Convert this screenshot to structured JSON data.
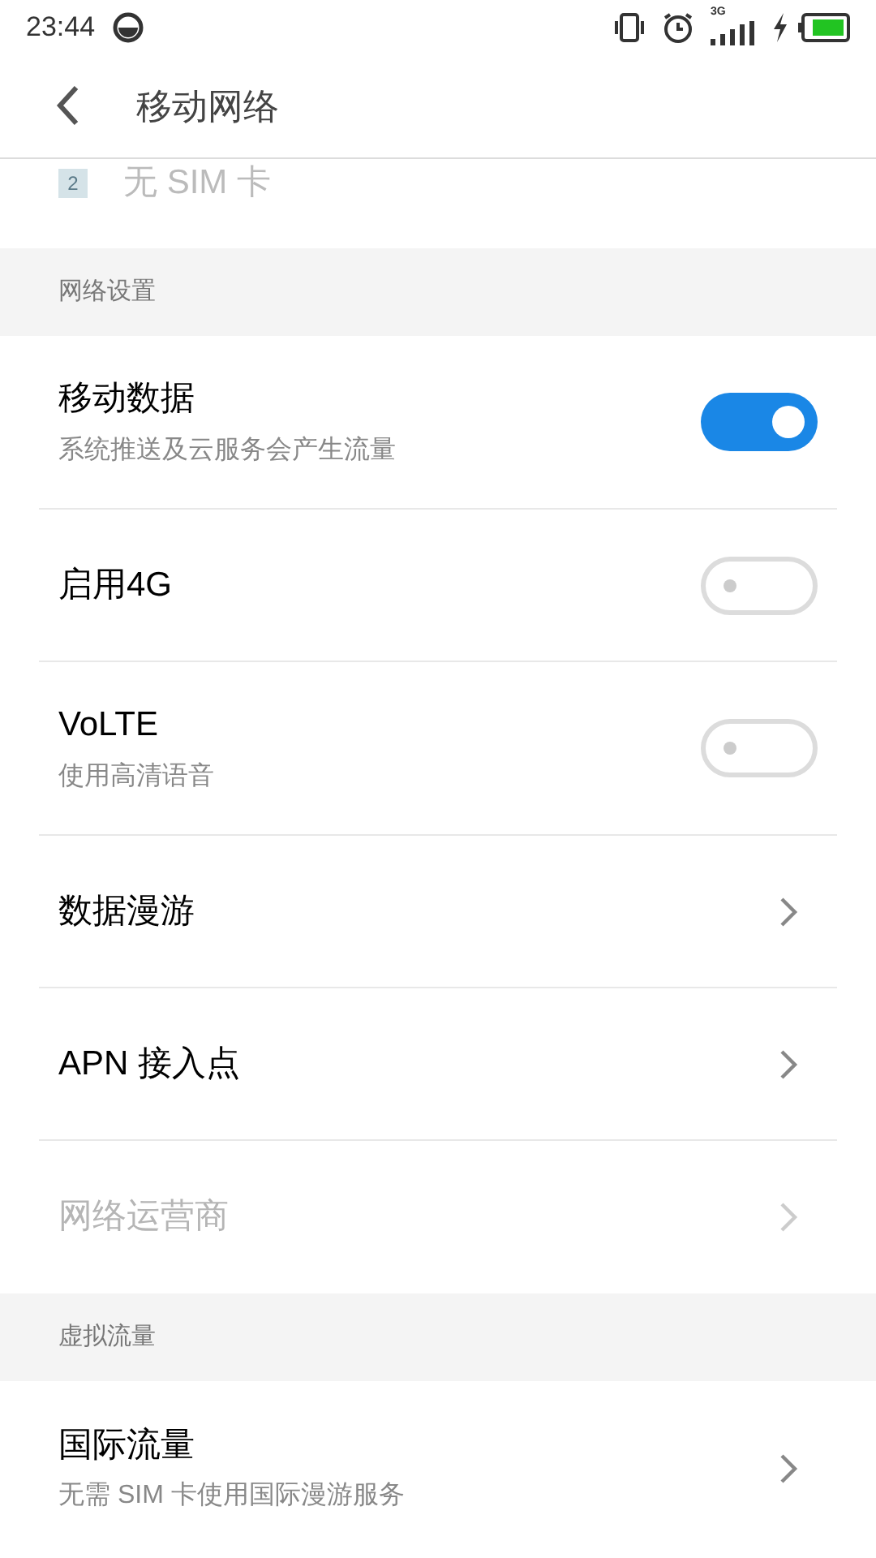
{
  "status_bar": {
    "time": "23:44",
    "network": "3G"
  },
  "header": {
    "title": "移动网络"
  },
  "sim_row": {
    "slot": "2",
    "label": "无 SIM 卡"
  },
  "sections": [
    {
      "title": "网络设置",
      "items": [
        {
          "kind": "toggle",
          "label": "移动数据",
          "subtitle": "系统推送及云服务会产生流量",
          "on": true,
          "disabled": false
        },
        {
          "kind": "toggle",
          "label": "启用4G",
          "on": false,
          "disabled": false
        },
        {
          "kind": "toggle",
          "label": "VoLTE",
          "subtitle": "使用高清语音",
          "on": false,
          "disabled": false
        },
        {
          "kind": "link",
          "label": "数据漫游",
          "disabled": false
        },
        {
          "kind": "link",
          "label": "APN 接入点",
          "disabled": false
        },
        {
          "kind": "link",
          "label": "网络运营商",
          "disabled": true
        }
      ]
    },
    {
      "title": "虚拟流量",
      "items": [
        {
          "kind": "link",
          "label": "国际流量",
          "subtitle": "无需 SIM 卡使用国际漫游服务",
          "disabled": false
        }
      ]
    }
  ]
}
